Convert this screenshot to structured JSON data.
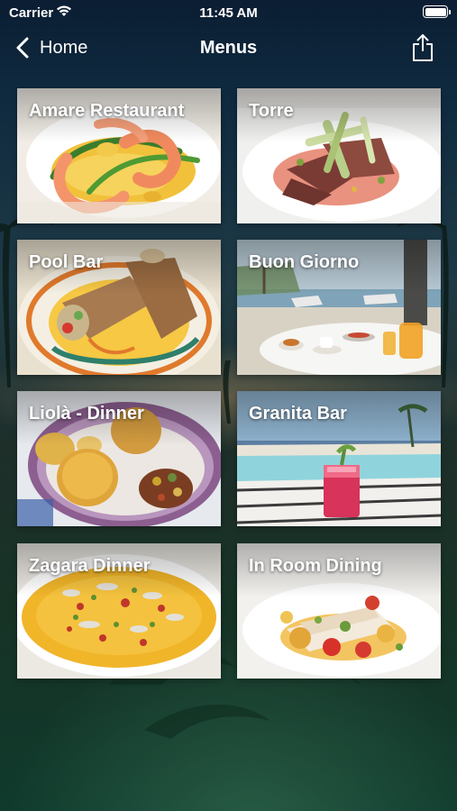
{
  "status_bar": {
    "carrier": "Carrier",
    "time": "11:45 AM",
    "battery_level": 1.0
  },
  "nav": {
    "back_label": "Home",
    "title": "Menus",
    "back_icon": "chevron-left-icon",
    "share_icon": "share-icon"
  },
  "menus": [
    {
      "title": "Amare Restaurant",
      "dish": "prawns"
    },
    {
      "title": "Torre",
      "dish": "beef-salad"
    },
    {
      "title": "Pool Bar",
      "dish": "cannoli"
    },
    {
      "title": "Buon Giorno",
      "dish": "breakfast-terrace"
    },
    {
      "title": "Liolà - Dinner",
      "dish": "arancini"
    },
    {
      "title": "Granita Bar",
      "dish": "pool-drink"
    },
    {
      "title": "Zagara Dinner",
      "dish": "risotto"
    },
    {
      "title": "In Room Dining",
      "dish": "fish"
    }
  ],
  "colors": {
    "text": "#ffffff",
    "card_background": "#f4f2ee"
  }
}
